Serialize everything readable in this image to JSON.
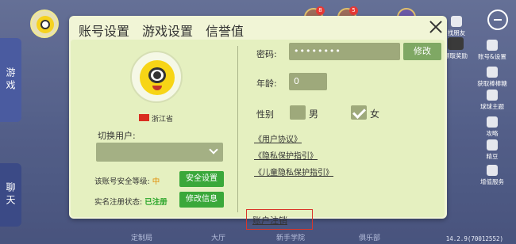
{
  "background": {
    "left_tabs": [
      "游戏",
      "聊天"
    ],
    "top_badges": [
      "8",
      "5"
    ],
    "bottom_nav": [
      "定制局",
      "大厅",
      "新手学院",
      "俱乐部"
    ],
    "version": "14.2.9(70012552)",
    "right_sidebar": [
      "找朋友",
      "账号&设置",
      "获取棒棒糖",
      "球球主题",
      "攻略",
      "精豆",
      "增值服务"
    ],
    "avatar_badge": "领取奖励"
  },
  "modal": {
    "tabs": [
      "账号设置",
      "游戏设置",
      "信誉值"
    ],
    "left": {
      "province": "浙江省",
      "switch_user_label": "切换用户:",
      "security_label": "该账号安全等级:",
      "security_level": "中",
      "security_button": "安全设置",
      "realname_label": "实名注册状态:",
      "realname_status": "已注册",
      "modify_button": "修改信息"
    },
    "right": {
      "password_label": "密码:",
      "password_value": "••••••••",
      "modify_label": "修改",
      "age_label": "年龄:",
      "age_value": "0",
      "gender_label": "性别",
      "male": "男",
      "female": "女",
      "links": [
        "《用户协议》",
        "《隐私保护指引》",
        "《儿童隐私保护指引》"
      ],
      "cancel_account": "账户注销"
    }
  },
  "colors": {
    "modal_bg": "#f1f5d6",
    "panel_bg": "#e5f0c0",
    "button_green": "#3aa83a",
    "field_olive": "#9ea97b",
    "highlight_red": "#d9362a"
  }
}
